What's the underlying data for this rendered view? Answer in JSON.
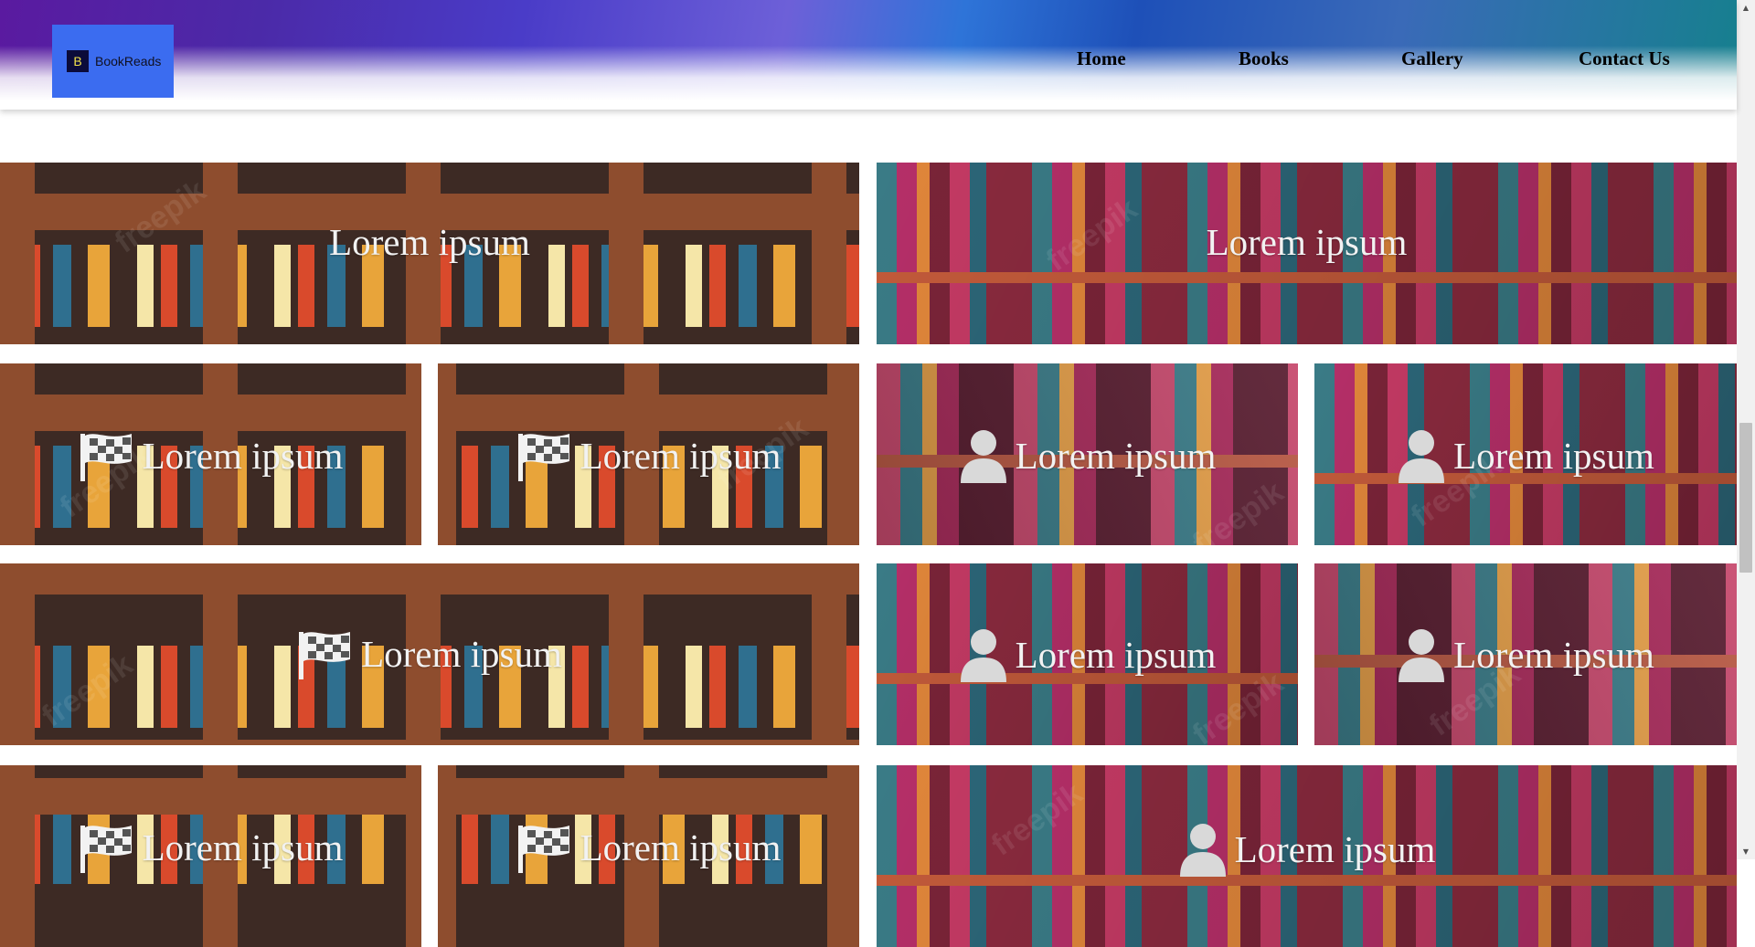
{
  "brand": {
    "mark": "B",
    "name": "BookReads"
  },
  "nav": {
    "items": [
      {
        "id": "home",
        "label": "Home"
      },
      {
        "id": "books",
        "label": "Books"
      },
      {
        "id": "gallery",
        "label": "Gallery"
      },
      {
        "id": "contact",
        "label": "Contact Us"
      }
    ]
  },
  "gallery": {
    "watermark": "freepik",
    "tiles": [
      {
        "text": "Lorem ipsum",
        "icon": "none"
      },
      {
        "text": "Lorem ipsum",
        "icon": "none"
      },
      {
        "text": "Lorem ipsum",
        "icon": "checkered-flag-icon"
      },
      {
        "text": "Lorem ipsum",
        "icon": "checkered-flag-icon"
      },
      {
        "text": "Lorem ipsum",
        "icon": "user-icon"
      },
      {
        "text": "Lorem ipsum",
        "icon": "user-icon"
      },
      {
        "text": "Lorem ipsum",
        "icon": "checkered-flag-icon"
      },
      {
        "text": "Lorem ipsum",
        "icon": "user-icon"
      },
      {
        "text": "Lorem ipsum",
        "icon": "user-icon"
      },
      {
        "text": "Lorem ipsum",
        "icon": "checkered-flag-icon"
      },
      {
        "text": "Lorem ipsum",
        "icon": "checkered-flag-icon"
      },
      {
        "text": "Lorem ipsum",
        "icon": "user-icon"
      }
    ]
  },
  "colors": {
    "logo_bg": "#3b6cf0",
    "caption": "#f2f2f2",
    "header_gradient_start": "#5a1aa0",
    "header_gradient_end": "#16808e"
  }
}
